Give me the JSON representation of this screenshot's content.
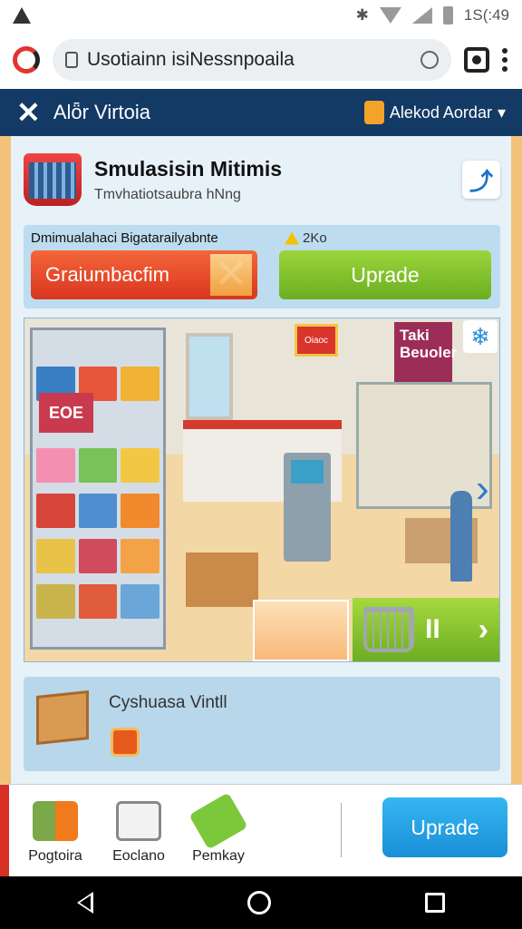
{
  "status_bar": {
    "time": "1S(:49"
  },
  "browser": {
    "url": "Usotiainn isiNessnpoaila"
  },
  "app_header": {
    "title": "Alȫr Virtoia",
    "account_label": "Alekod Aordar"
  },
  "title_card": {
    "title": "Smulasisin Mitimis",
    "subtitle": "Tmvhatiotsaubra hNng"
  },
  "action_bar": {
    "caption": "Dmimualahaci Bigatarailyabnte",
    "warning": "2Ko",
    "left_button": "Graiumbacfim",
    "right_button": "Uprade"
  },
  "scene": {
    "sale_sign": "Taki Beuoler",
    "box_label": "EOE",
    "small_sign": "Oiaoc",
    "snow_icon": "❄",
    "tile_controls": [
      "II",
      "›"
    ]
  },
  "info_card": {
    "title": "Cyshuasa Vintll"
  },
  "dock": {
    "items": [
      {
        "label": "Pogtoira",
        "icon": "produce-icon"
      },
      {
        "label": "Eoclano",
        "icon": "card-icon"
      },
      {
        "label": "Pemkay",
        "icon": "spray-icon"
      }
    ],
    "upgrade_label": "Uprade"
  },
  "colors": {
    "header_bg": "#123a64",
    "primary_red": "#e0432a",
    "primary_green": "#7cc02c",
    "primary_blue": "#1a8fd6"
  }
}
